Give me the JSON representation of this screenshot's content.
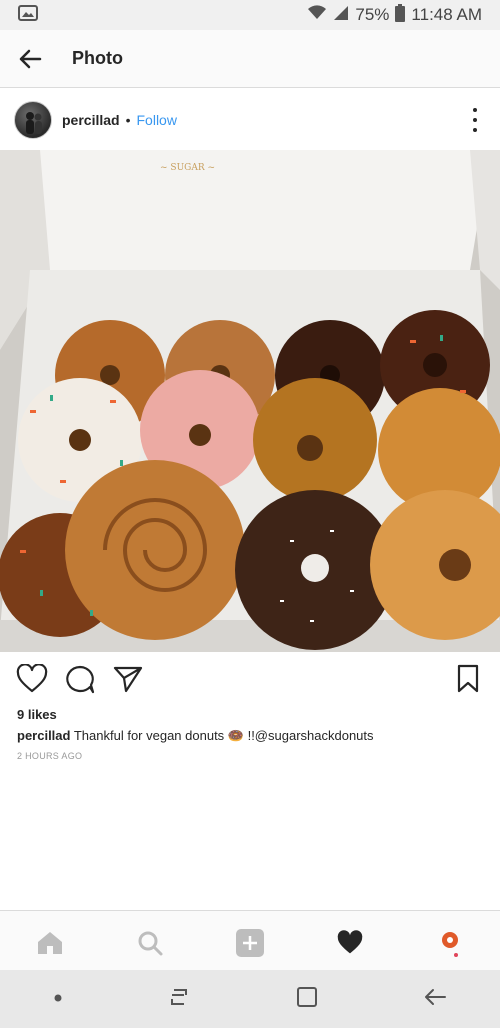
{
  "status_bar": {
    "battery": "75%",
    "time": "11:48 AM",
    "icons": [
      "gallery-icon",
      "wifi-icon",
      "signal-icon",
      "battery-icon"
    ]
  },
  "header": {
    "title": "Photo",
    "back_icon": "arrow-left-icon"
  },
  "post": {
    "username": "percillad",
    "separator": "•",
    "follow_label": "Follow",
    "photo_alt": "Box of donuts",
    "likes": "9 likes",
    "caption_user": "percillad",
    "caption_text": "Thankful for vegan donuts 🍩 !!@sugarshackdonuts",
    "time_ago": "2 HOURS AGO"
  },
  "actions": {
    "like": "heart-icon",
    "comment": "comment-icon",
    "share": "send-icon",
    "save": "bookmark-icon"
  },
  "bottom_nav": {
    "items": [
      "home-icon",
      "search-icon",
      "add-icon",
      "activity-icon",
      "profile-icon"
    ]
  },
  "colors": {
    "link": "#3897f0",
    "text": "#262626",
    "muted": "#999999"
  }
}
